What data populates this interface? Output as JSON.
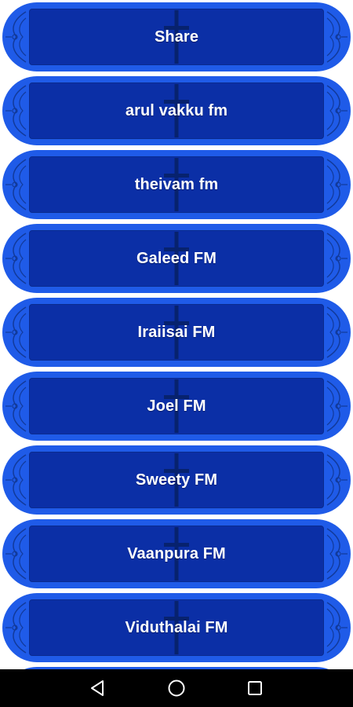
{
  "menu": {
    "items": [
      {
        "label": "Share"
      },
      {
        "label": "arul vakku fm"
      },
      {
        "label": "theivam fm"
      },
      {
        "label": "Galeed FM"
      },
      {
        "label": "Iraiisai FM"
      },
      {
        "label": "Joel FM"
      },
      {
        "label": "Sweety FM"
      },
      {
        "label": "Vaanpura FM"
      },
      {
        "label": "Viduthalai FM"
      },
      {
        "label": ""
      }
    ]
  },
  "navigation_bar": {
    "buttons": [
      "back-icon",
      "home-icon",
      "recents-icon"
    ]
  },
  "colors": {
    "button_outer": "#1f5be8",
    "button_inner": "#0b2fa6",
    "nav_bar": "#000000"
  }
}
